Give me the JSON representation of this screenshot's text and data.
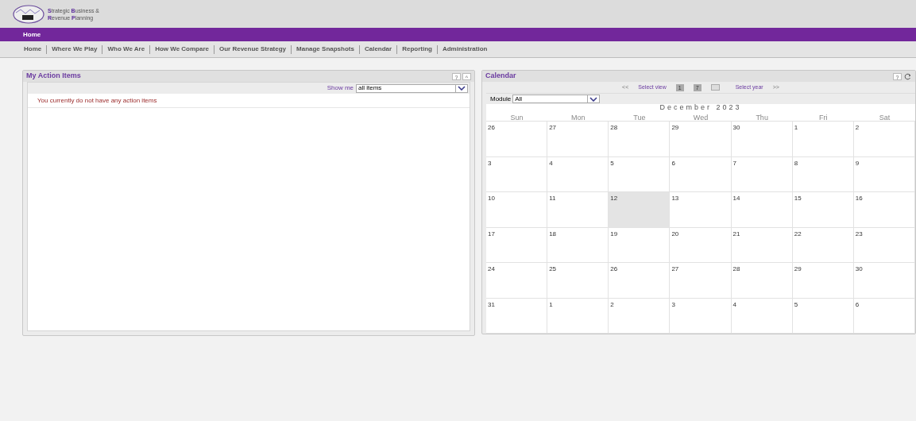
{
  "logo": {
    "line_1": "**S**trategic **B**usiness &",
    "line_2": "**R**evenue **P**lanning"
  },
  "breadcrumb": "Home",
  "nav": [
    "Home",
    "Where We Play",
    "Who We Are",
    "How We Compare",
    "Our Revenue Strategy",
    "Manage Snapshots",
    "Calendar",
    "Reporting",
    "Administration"
  ],
  "action_items": {
    "title": "My Action Items",
    "help": "?",
    "collapse": "^",
    "filter_label": "Show me",
    "filter_value": "all items",
    "empty_message": "You currently do not have any action items"
  },
  "calendar": {
    "title": "Calendar",
    "help": "?",
    "prev": "<<",
    "select_view": "Select view",
    "view_day": "1",
    "view_week": "7",
    "select_year": "Select year",
    "next": ">>",
    "module_label": "Module",
    "module_value": "All",
    "month": "December 2023",
    "weekdays": [
      "Sun",
      "Mon",
      "Tue",
      "Wed",
      "Thu",
      "Fri",
      "Sat"
    ],
    "weeks": [
      [
        {
          "day": "26",
          "selected": false
        },
        {
          "day": "27",
          "selected": false
        },
        {
          "day": "28",
          "selected": false
        },
        {
          "day": "29",
          "selected": false
        },
        {
          "day": "30",
          "selected": false
        },
        {
          "day": "1",
          "selected": false
        },
        {
          "day": "2",
          "selected": false
        }
      ],
      [
        {
          "day": "3",
          "selected": false
        },
        {
          "day": "4",
          "selected": false
        },
        {
          "day": "5",
          "selected": false
        },
        {
          "day": "6",
          "selected": false
        },
        {
          "day": "7",
          "selected": false
        },
        {
          "day": "8",
          "selected": false
        },
        {
          "day": "9",
          "selected": false
        }
      ],
      [
        {
          "day": "10",
          "selected": false
        },
        {
          "day": "11",
          "selected": false
        },
        {
          "day": "12",
          "selected": true
        },
        {
          "day": "13",
          "selected": false
        },
        {
          "day": "14",
          "selected": false
        },
        {
          "day": "15",
          "selected": false
        },
        {
          "day": "16",
          "selected": false
        }
      ],
      [
        {
          "day": "17",
          "selected": false
        },
        {
          "day": "18",
          "selected": false
        },
        {
          "day": "19",
          "selected": false
        },
        {
          "day": "20",
          "selected": false
        },
        {
          "day": "21",
          "selected": false
        },
        {
          "day": "22",
          "selected": false
        },
        {
          "day": "23",
          "selected": false
        }
      ],
      [
        {
          "day": "24",
          "selected": false
        },
        {
          "day": "25",
          "selected": false
        },
        {
          "day": "26",
          "selected": false
        },
        {
          "day": "27",
          "selected": false
        },
        {
          "day": "28",
          "selected": false
        },
        {
          "day": "29",
          "selected": false
        },
        {
          "day": "30",
          "selected": false
        }
      ],
      [
        {
          "day": "31",
          "selected": false
        },
        {
          "day": "1",
          "selected": false
        },
        {
          "day": "2",
          "selected": false
        },
        {
          "day": "3",
          "selected": false
        },
        {
          "day": "4",
          "selected": false
        },
        {
          "day": "5",
          "selected": false
        },
        {
          "day": "6",
          "selected": false
        }
      ]
    ]
  }
}
